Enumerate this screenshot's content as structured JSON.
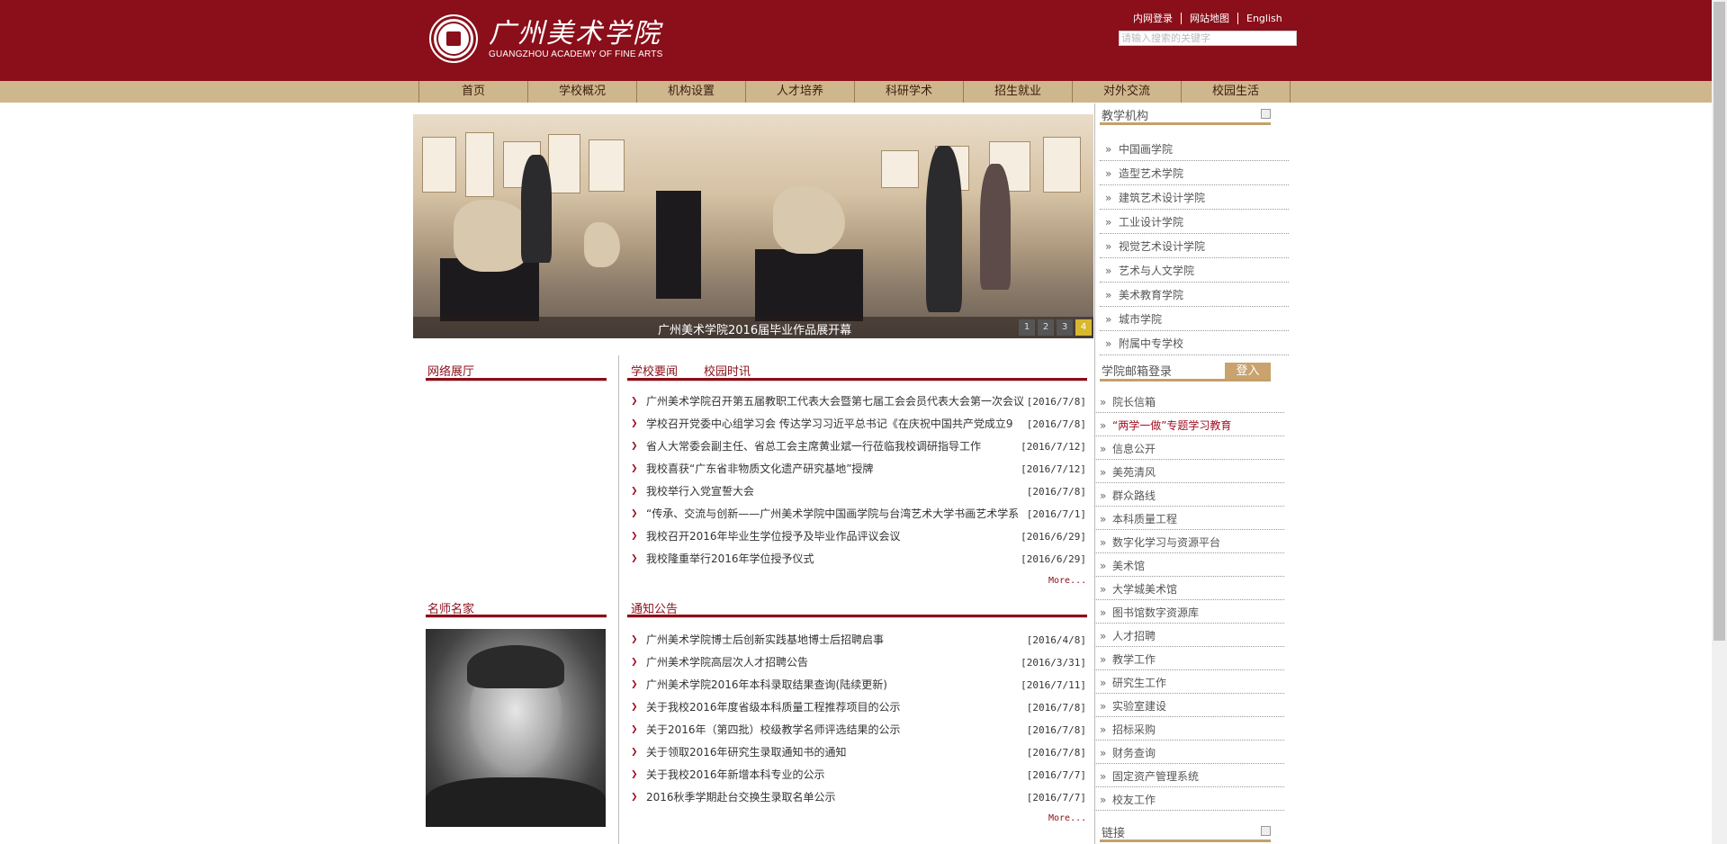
{
  "header": {
    "logo_cn": "广州美术学院",
    "logo_en": "GUANGZHOU ACADEMY OF FINE ARTS",
    "links": [
      "内网登录",
      "网站地图",
      "English"
    ],
    "search_placeholder": "请输入搜索的关键字"
  },
  "nav": [
    "首页",
    "学校概况",
    "机构设置",
    "人才培养",
    "科研学术",
    "招生就业",
    "对外交流",
    "校园生活"
  ],
  "banner": {
    "caption": "广州美术学院2016届毕业作品展开幕",
    "dots": [
      "1",
      "2",
      "3",
      "4"
    ],
    "active": "4"
  },
  "sections": {
    "exhibition": "网络展厅",
    "masters": "名师名家",
    "news_tab1": "学校要闻",
    "news_tab2": "校园时讯",
    "notice": "通知公告",
    "more": "More..."
  },
  "news": [
    {
      "title": "广州美术学院召开第五届教职工代表大会暨第七届工会会员代表大会第一次会议",
      "date": "[2016/7/8]"
    },
    {
      "title": "学校召开党委中心组学习会 传达学习习近平总书记《在庆祝中国共产党成立9",
      "date": "[2016/7/8]"
    },
    {
      "title": "省人大常委会副主任、省总工会主席黄业斌一行莅临我校调研指导工作",
      "date": "[2016/7/12]"
    },
    {
      "title": "我校喜获“广东省非物质文化遗产研究基地”授牌",
      "date": "[2016/7/12]"
    },
    {
      "title": "我校举行入党宣誓大会",
      "date": "[2016/7/8]"
    },
    {
      "title": "“传承、交流与创新——广州美术学院中国画学院与台湾艺术大学书画艺术学系",
      "date": "[2016/7/1]"
    },
    {
      "title": "我校召开2016年毕业生学位授予及毕业作品评议会议",
      "date": "[2016/6/29]"
    },
    {
      "title": "我校隆重举行2016年学位授予仪式",
      "date": "[2016/6/29]"
    }
  ],
  "notices": [
    {
      "title": "广州美术学院博士后创新实践基地博士后招聘启事",
      "date": "[2016/4/8]"
    },
    {
      "title": "广州美术学院高层次人才招聘公告",
      "date": "[2016/3/31]"
    },
    {
      "title": "广州美术学院2016年本科录取结果查询(陆续更新)",
      "date": "[2016/7/11]"
    },
    {
      "title": "关于我校2016年度省级本科质量工程推荐项目的公示",
      "date": "[2016/7/8]"
    },
    {
      "title": "关于2016年（第四批）校级教学名师评选结果的公示",
      "date": "[2016/7/8]"
    },
    {
      "title": "关于领取2016年研究生录取通知书的通知",
      "date": "[2016/7/8]"
    },
    {
      "title": "关于我校2016年新增本科专业的公示",
      "date": "[2016/7/7]"
    },
    {
      "title": "2016秋季学期赴台交换生录取名单公示",
      "date": "[2016/7/7]"
    }
  ],
  "sidebar": {
    "teaching_title": "教学机构",
    "teaching": [
      "中国画学院",
      "造型艺术学院",
      "建筑艺术设计学院",
      "工业设计学院",
      "视觉艺术设计学院",
      "艺术与人文学院",
      "美术教育学院",
      "城市学院",
      "附属中专学校"
    ],
    "mail_title": "学院邮箱登录",
    "login": "登入",
    "links": [
      "院长信箱",
      "“两学一做”专题学习教育",
      "信息公开",
      "美苑清风",
      "群众路线",
      "本科质量工程",
      "数字化学习与资源平台",
      "美术馆",
      "大学城美术馆",
      "图书馆数字资源库",
      "人才招聘",
      "教学工作",
      "研究生工作",
      "实验室建设",
      "招标采购",
      "财务查询",
      "固定资产管理系统",
      "校友工作"
    ],
    "friends_title": "链接"
  },
  "colors": {
    "brand": "#8a0f1a",
    "nav": "#cfb78d",
    "gold": "#c4a06a"
  }
}
